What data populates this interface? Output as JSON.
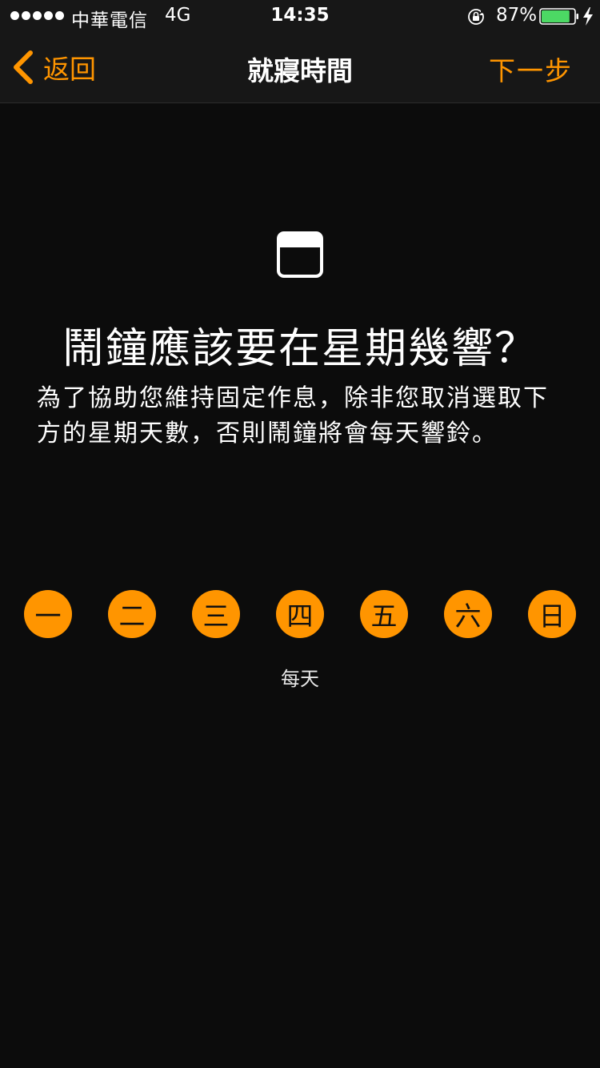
{
  "status_bar": {
    "carrier": "中華電信",
    "network": "4G",
    "time": "14:35",
    "battery_percent": "87%",
    "battery_level": 0.87,
    "signal_bars": 5,
    "icons": [
      "signal-dots-icon",
      "rotation-lock-icon",
      "battery-icon",
      "charging-bolt-icon"
    ]
  },
  "nav": {
    "back_label": "返回",
    "title": "就寢時間",
    "next_label": "下一步",
    "icons": [
      "chevron-left-icon"
    ]
  },
  "main": {
    "icon": "calendar-icon",
    "question": "鬧鐘應該要在星期幾響？",
    "description": "為了協助您維持固定作息，除非您取消選取下方的星期天數，否則鬧鐘將會每天響鈴。",
    "days": [
      {
        "label": "一",
        "selected": true
      },
      {
        "label": "二",
        "selected": true
      },
      {
        "label": "三",
        "selected": true
      },
      {
        "label": "四",
        "selected": true
      },
      {
        "label": "五",
        "selected": true
      },
      {
        "label": "六",
        "selected": true
      },
      {
        "label": "日",
        "selected": true
      }
    ],
    "repeat_summary": "每天"
  },
  "colors": {
    "accent": "#ff9500",
    "background": "#0c0c0c",
    "bar_background": "#171717",
    "battery_fill": "#4cd964"
  }
}
